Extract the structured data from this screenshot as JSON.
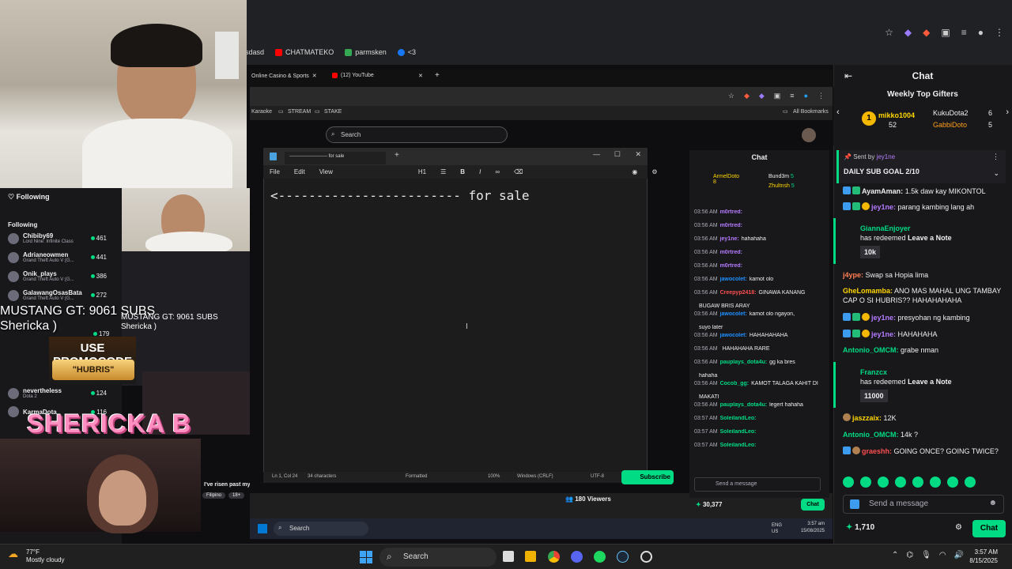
{
  "outer_browser": {
    "bookmarks": [
      {
        "label": "sdasd",
        "color": "#888"
      },
      {
        "label": "CHATMATEKO",
        "color": "#ff0000"
      },
      {
        "label": "parmsken",
        "color": "#34a853"
      },
      {
        "label": "<3",
        "color": "#1877f2"
      }
    ]
  },
  "left_panel": {
    "header": "Following",
    "section": "Following",
    "channels": [
      {
        "name": "Chibiby69",
        "game": "Lord Nine: Infinite Class",
        "count": "461"
      },
      {
        "name": "Adrianeowmen",
        "game": "Grand Theft Auto V (G...",
        "count": "441"
      },
      {
        "name": "Onik_plays",
        "game": "Grand Theft Auto V (G...",
        "count": "386"
      },
      {
        "name": "GalawangOsasBata",
        "game": "Grand Theft Auto V (G...",
        "count": "272"
      },
      {
        "name": "nevertheless",
        "game": "Dota 2",
        "count": "124"
      },
      {
        "name": "KarmaDota",
        "game": "",
        "count": "116"
      }
    ],
    "hidden_count": "179"
  },
  "overlay": {
    "sub_goal_line1": "MUSTANG GT: 9061 SUBS",
    "sub_goal_line2": "Shericka )",
    "promo_line1": "USE PROMOCODE",
    "promo_code": "\"HUBRIS\"",
    "streamer_name": "SHERICKA B",
    "quote": "I've risen past myself.",
    "tags": [
      "Filipino",
      "18+"
    ]
  },
  "inner_browser": {
    "tabs": [
      {
        "label": "Online Casino & Sports"
      },
      {
        "label": "(12) YouTube"
      }
    ],
    "bookmarks": [
      "Karaoke",
      "STREAM",
      "STAKE",
      "All Bookmarks"
    ],
    "search_placeholder": "Search"
  },
  "notepad": {
    "tab_title": "------------------------ for sale",
    "menu": [
      "File",
      "Edit",
      "View"
    ],
    "heading_label": "H1",
    "content": "<------------------------ for sale",
    "status": {
      "position": "Ln 1, Col 24",
      "chars": "34 characters",
      "format": "Formatted",
      "zoom": "100%",
      "eol": "Windows (CRLF)",
      "encoding": "UTF-8"
    }
  },
  "inner_chat": {
    "title": "Chat",
    "gifters": [
      {
        "name": "ArmelDoto",
        "count": "8"
      },
      {
        "name": "Bund3m",
        "count": "5"
      },
      {
        "name": "Zhultnsh",
        "count": "5"
      }
    ],
    "messages": [
      {
        "time": "03:56 AM",
        "user": "m0rtred:",
        "color": "#b57bff",
        "text": ""
      },
      {
        "time": "03:56 AM",
        "user": "m0rtred:",
        "color": "#b57bff",
        "text": ""
      },
      {
        "time": "03:56 AM",
        "user": "jey1ne:",
        "color": "#b57bff",
        "text": "hahahaha"
      },
      {
        "time": "03:56 AM",
        "user": "m0rtred:",
        "color": "#b57bff",
        "text": ""
      },
      {
        "time": "03:56 AM",
        "user": "m0rtred:",
        "color": "#b57bff",
        "text": ""
      },
      {
        "time": "03:56 AM",
        "user": "jawocolet:",
        "color": "#1e90ff",
        "text": "kamot olo"
      },
      {
        "time": "03:56 AM",
        "user": "Creepyp2418:",
        "color": "#ff4f4f",
        "text": "GINAWA KANANG"
      },
      {
        "time": "",
        "user": "",
        "color": "#efeff1",
        "text": "BUGAW BRIS ARAY"
      },
      {
        "time": "03:56 AM",
        "user": "jawocolet:",
        "color": "#1e90ff",
        "text": "kamot olo ngayon,"
      },
      {
        "time": "",
        "user": "",
        "color": "#efeff1",
        "text": "suyo later"
      },
      {
        "time": "03:56 AM",
        "user": "jawocolet:",
        "color": "#1e90ff",
        "text": "HAHAHAHAHA"
      },
      {
        "time": "03:56 AM",
        "user": "",
        "color": "#ff4f4f",
        "text": "HAHAHAHA RARE"
      },
      {
        "time": "03:56 AM",
        "user": "pauplays_dota4u:",
        "color": "#00db84",
        "text": "gg ka bres"
      },
      {
        "time": "",
        "user": "",
        "color": "#efeff1",
        "text": "hahaha"
      },
      {
        "time": "03:56 AM",
        "user": "Cocob_gg:",
        "color": "#00db84",
        "text": "KAMOT TALAGA KAHIT DI"
      },
      {
        "time": "",
        "user": "",
        "color": "#efeff1",
        "text": "MAKATI"
      },
      {
        "time": "03:56 AM",
        "user": "pauplays_dota4u:",
        "color": "#00db84",
        "text": "legert hahaha"
      },
      {
        "time": "03:57 AM",
        "user": "SoleilandLeo:",
        "color": "#00db84",
        "text": ""
      },
      {
        "time": "03:57 AM",
        "user": "SoleilandLeo:",
        "color": "#00db84",
        "text": ""
      },
      {
        "time": "03:57 AM",
        "user": "SoleilandLeo:",
        "color": "#00db84",
        "text": ""
      }
    ],
    "input_placeholder": "Send a message",
    "points": "30,377",
    "chat_button": "Chat",
    "viewers": "180 Viewers",
    "subscribe": "Subscribe"
  },
  "inner_taskbar": {
    "search": "Search",
    "lang": "ENG\nUS",
    "time": "3:57 am",
    "date": "15/08/2025"
  },
  "right_chat": {
    "title": "Chat",
    "weekly_title": "Weekly Top Gifters",
    "gifters": [
      {
        "name": "mikko1004",
        "count": "52"
      },
      {
        "name": "KukuDota2",
        "count": "6"
      },
      {
        "name": "GabbiDoto",
        "count": "5"
      }
    ],
    "goal_sent_by": "Sent by",
    "goal_user": "jey1ne",
    "goal_text": "DAILY SUB GOAL 2/10",
    "messages": [
      {
        "user": "AyamAman:",
        "color": "#00db84",
        "text": "1.5k daw kay MIKONTOL"
      },
      {
        "user": "jey1ne:",
        "color": "#b57bff",
        "text": "parang kambing lang ah"
      },
      {
        "user": "j4ype:",
        "color": "#ff7f50",
        "text": "Swap sa Hopia lima"
      },
      {
        "user": "GheLomamba:",
        "color": "#ffd700",
        "text": "ANO MAS MAHAL UNG TAMBAY CAP O SI HUBRIS?? HAHAHAHAHA"
      },
      {
        "user": "jey1ne:",
        "color": "#b57bff",
        "text": "presyohan ng kambing"
      },
      {
        "user": "jey1ne:",
        "color": "#b57bff",
        "text": "HAHAHAHA"
      },
      {
        "user": "Antonio_OMCM:",
        "color": "#00db84",
        "text": "grabe nman"
      },
      {
        "user": "jaszzaix:",
        "color": "#ffd700",
        "text": "12K"
      },
      {
        "user": "Antonio_OMCM:",
        "color": "#00db84",
        "text": "14k ?"
      },
      {
        "user": "graeshh:",
        "color": "#ff4f4f",
        "text": "GOING ONCE? GOING TWICE?"
      }
    ],
    "redeem1": {
      "user": "GiannaEnjoyer",
      "action": "has redeemed",
      "reward": "Leave a Note",
      "value": "10k"
    },
    "redeem2": {
      "user": "Franzcx",
      "action": "has redeemed",
      "reward": "Leave a Note",
      "value": "11000"
    },
    "input_placeholder": "Send a message",
    "points": "1,710",
    "chat_button": "Chat"
  },
  "taskbar": {
    "weather_temp": "77°F",
    "weather_desc": "Mostly cloudy",
    "search": "Search",
    "time": "3:57 AM",
    "date": "8/15/2025"
  }
}
